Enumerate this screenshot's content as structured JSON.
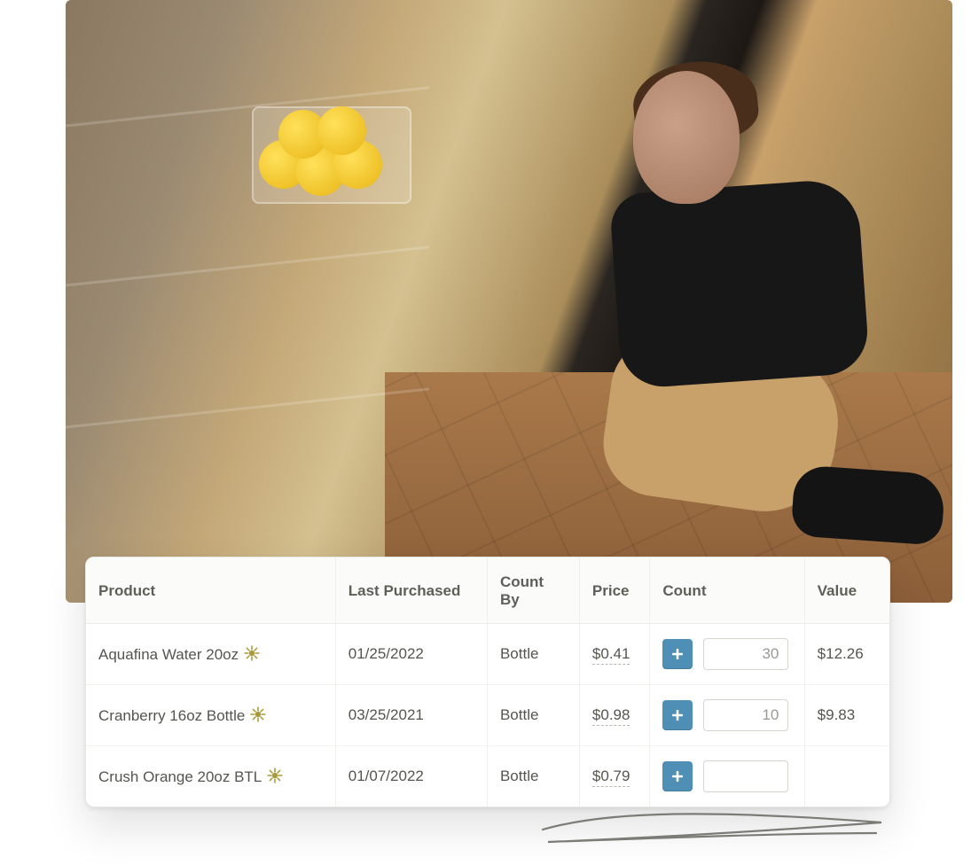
{
  "photo_alt": "A man kneeling in a storage room checking inventory with a handheld device",
  "table": {
    "headers": {
      "product": "Product",
      "last_purchased": "Last Purchased",
      "count_by": "Count By",
      "price": "Price",
      "count": "Count",
      "value": "Value"
    },
    "rows": [
      {
        "product": "Aquafina Water 20oz",
        "starred": true,
        "last_purchased": "01/25/2022",
        "count_by": "Bottle",
        "price": "$0.41",
        "count": "30",
        "value": "$12.26"
      },
      {
        "product": "Cranberry 16oz Bottle",
        "starred": true,
        "last_purchased": "03/25/2021",
        "count_by": "Bottle",
        "price": "$0.98",
        "count": "10",
        "value": "$9.83"
      },
      {
        "product": "Crush Orange 20oz BTL",
        "starred": true,
        "last_purchased": "01/07/2022",
        "count_by": "Bottle",
        "price": "$0.79",
        "count": "",
        "value": ""
      }
    ]
  },
  "icons": {
    "star_color": "#a89a3a",
    "plus_bg": "#4f8fb5"
  }
}
